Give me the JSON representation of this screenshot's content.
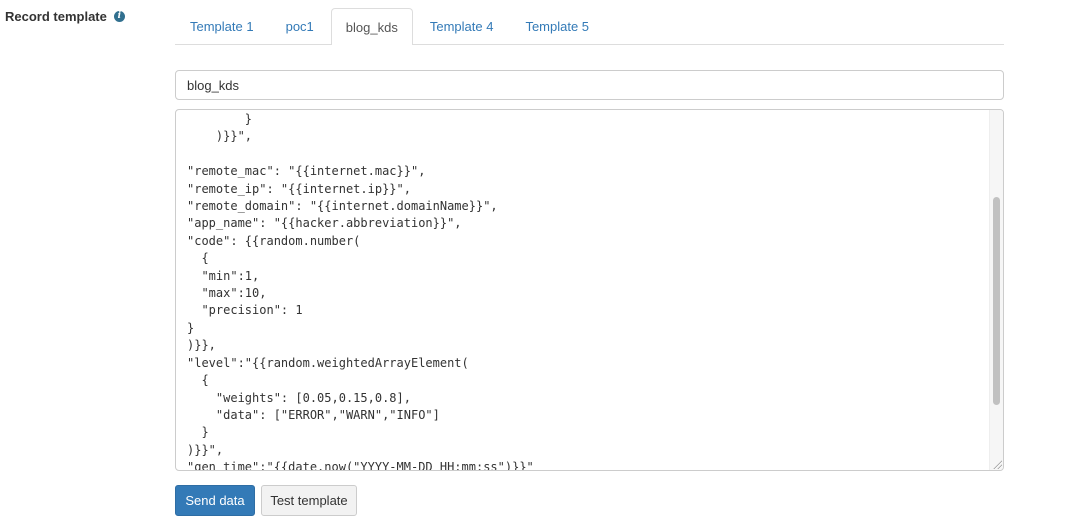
{
  "form": {
    "label": "Record template",
    "info_icon": "info-icon"
  },
  "tabs": [
    {
      "label": "Template 1",
      "active": false
    },
    {
      "label": "poc1",
      "active": false
    },
    {
      "label": "blog_kds",
      "active": true
    },
    {
      "label": "Template 4",
      "active": false
    },
    {
      "label": "Template 5",
      "active": false
    }
  ],
  "template_name": {
    "value": "blog_kds"
  },
  "editor": {
    "content": "        }\n    )}}\",\n\n\"remote_mac\": \"{{internet.mac}}\",\n\"remote_ip\": \"{{internet.ip}}\",\n\"remote_domain\": \"{{internet.domainName}}\",\n\"app_name\": \"{{hacker.abbreviation}}\",\n\"code\": {{random.number(\n  {\n  \"min\":1,\n  \"max\":10,\n  \"precision\": 1\n}\n)}},\n\"level\":\"{{random.weightedArrayElement(\n  {\n    \"weights\": [0.05,0.15,0.8],\n    \"data\": [\"ERROR\",\"WARN\",\"INFO\"]\n  }\n)}}\",\n\"gen_time\":\"{{date.now(\"YYYY-MM-DD HH:mm:ss\")}}\""
  },
  "buttons": {
    "send": "Send data",
    "test": "Test template"
  }
}
